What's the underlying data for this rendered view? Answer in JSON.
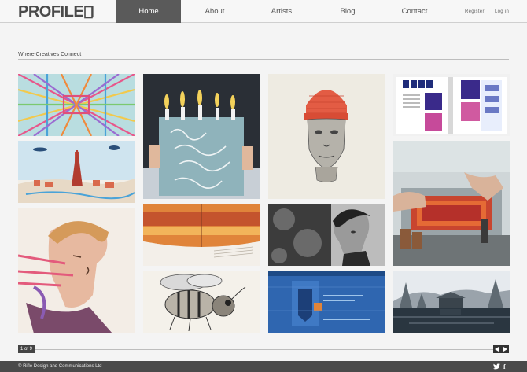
{
  "brand": {
    "logo_text": "PROFILE"
  },
  "nav": {
    "items": [
      {
        "label": "Home"
      },
      {
        "label": "About"
      },
      {
        "label": "Artists"
      },
      {
        "label": "Blog"
      },
      {
        "label": "Contact"
      }
    ],
    "active": "Home"
  },
  "auth": {
    "register": "Register",
    "login": "Log in"
  },
  "tagline": "Where Creatives Connect",
  "pagination": {
    "label": "1 of 9",
    "prev_icon": "chevron-left-icon",
    "next_icon": "chevron-right-icon"
  },
  "footer": {
    "copyright": "© Rifle Design and Communications Ltd"
  },
  "colors": {
    "header_active": "#5a5a5a",
    "footer_bg": "#4a4a4a",
    "page_bg": "#f4f4f4"
  }
}
